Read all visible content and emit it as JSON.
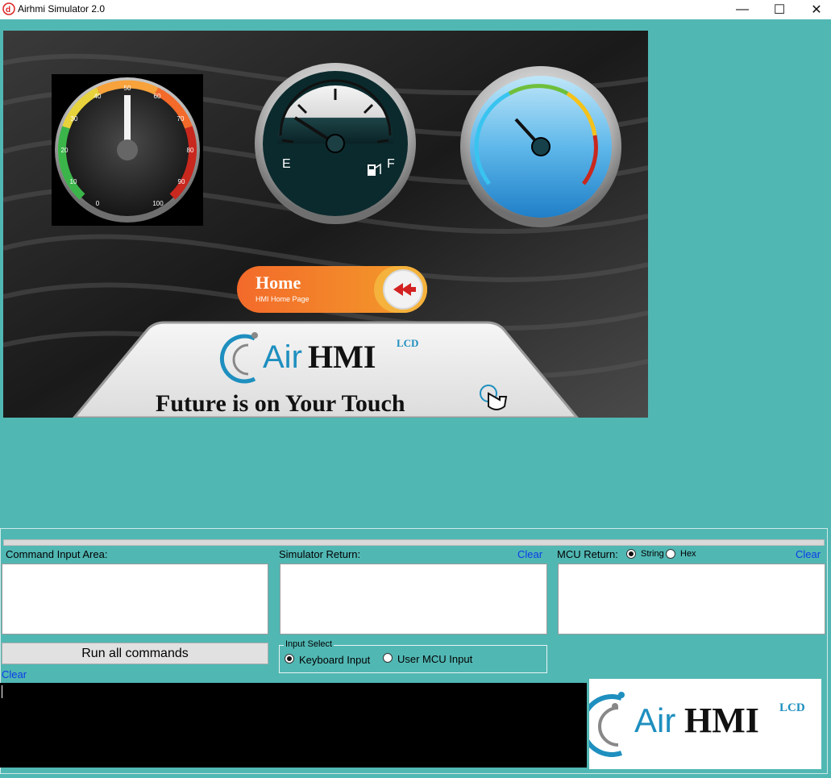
{
  "window": {
    "title": "Airhmi Simulator 2.0",
    "controls": {
      "minimize": "—",
      "maximize": "☐",
      "close": "✕"
    }
  },
  "hmi": {
    "gauge1_ticks": [
      "0",
      "10",
      "20",
      "30",
      "40",
      "50",
      "60",
      "70",
      "80",
      "90",
      "100"
    ],
    "fuel_gauge": {
      "empty_label": "E",
      "full_label": "F"
    },
    "home_button": {
      "title": "Home",
      "subtitle": "HMI Home Page"
    },
    "brand": {
      "air": "Air",
      "hmi": "HMI",
      "lcd": "LCD"
    },
    "slogan": "Future is on Your Touch"
  },
  "console": {
    "command_input_label": "Command Input Area:",
    "simulator_return_label": "Simulator Return:",
    "mcu_return_label": "MCU Return:",
    "mcu_format": {
      "selected": "String",
      "options": [
        "String",
        "Hex"
      ]
    },
    "clear_label": "Clear",
    "run_button_label": "Run all commands",
    "input_select": {
      "legend": "Input Select",
      "selected": "Keyboard Input",
      "options": [
        "Keyboard Input",
        "User MCU Input"
      ]
    },
    "logo": {
      "air": "Air",
      "hmi": "HMI",
      "lcd": "LCD"
    }
  },
  "colors": {
    "background": "#51b7b3",
    "link": "#0b3be8",
    "brand_blue": "#1e8fbf",
    "home_orange": "#f05a24"
  }
}
